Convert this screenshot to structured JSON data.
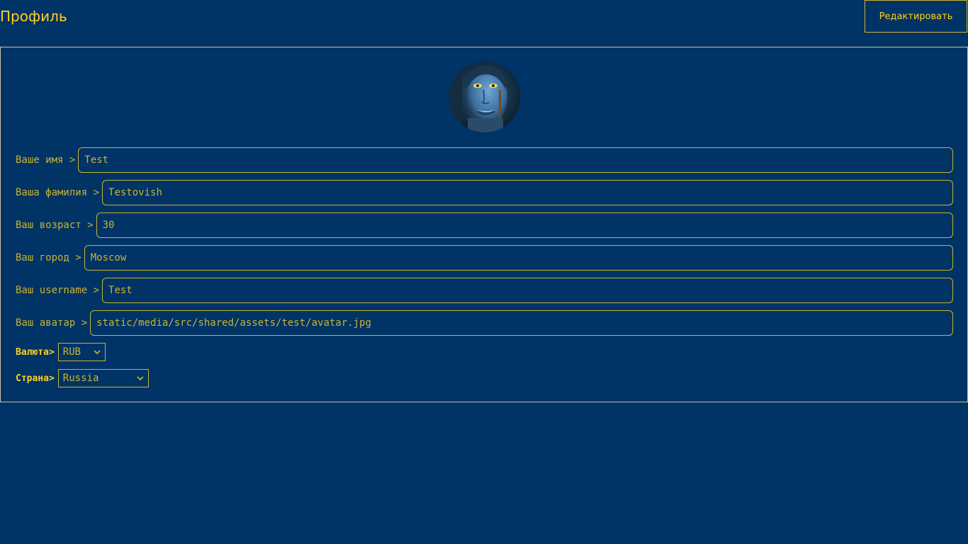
{
  "header": {
    "title": "Профиль",
    "edit_label": "Редактировать"
  },
  "profile": {
    "avatar_alt": "avatar",
    "fields": {
      "first_name": {
        "label": "Ваше имя >",
        "value": "Test"
      },
      "last_name": {
        "label": "Ваша фамилия >",
        "value": "Testovish"
      },
      "age": {
        "label": "Ваш возраст >",
        "value": "30"
      },
      "city": {
        "label": "Ваш город >",
        "value": "Moscow"
      },
      "username": {
        "label": "Ваш username >",
        "value": "Test"
      },
      "avatar": {
        "label": "Ваш аватар >",
        "value": "static/media/src/shared/assets/test/avatar.jpg"
      }
    },
    "currency": {
      "label": "Валюта>",
      "selected": "RUB"
    },
    "country": {
      "label": "Страна>",
      "selected": "Russia"
    }
  },
  "colors": {
    "background": "#003366",
    "accent": "#ffd21f",
    "text": "#c8b432"
  },
  "icons": [
    "chevron-down-icon",
    "chevron-down-icon"
  ]
}
